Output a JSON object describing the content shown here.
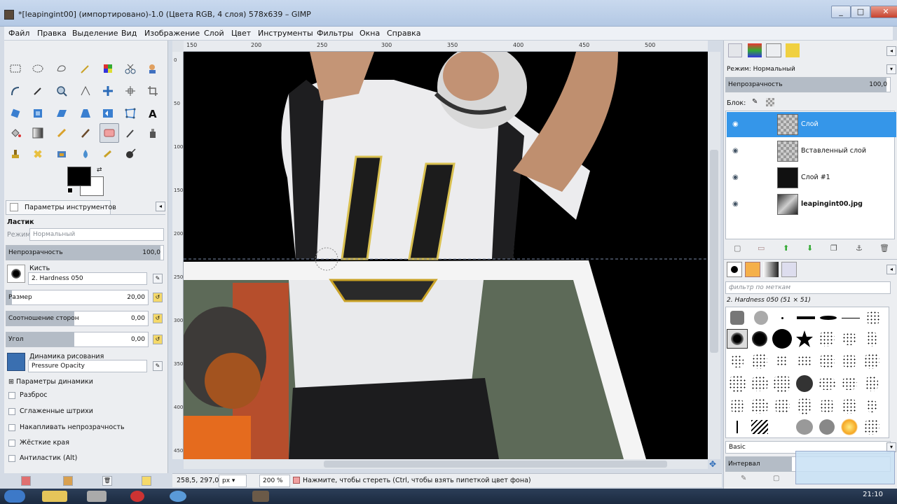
{
  "window": {
    "title": "*[leapingint00] (импортировано)-1.0 (Цвета RGB, 4 слоя) 578x639 – GIMP",
    "minimize": "_",
    "maximize": "□",
    "close": "✕"
  },
  "menu": [
    "Файл",
    "Правка",
    "Выделение",
    "Вид",
    "Изображение",
    "Слой",
    "Цвет",
    "Инструменты",
    "Фильтры",
    "Окна",
    "Справка"
  ],
  "tool_options": {
    "tab_label": "Параметры инструментов",
    "tool_name": "Ластик",
    "mode_label": "Режим:",
    "mode_value": "Нормальный",
    "opacity_label": "Непрозрачность",
    "opacity_value": "100,0",
    "brush_label": "Кисть",
    "brush_value": "2. Hardness 050",
    "size_label": "Размер",
    "size_value": "20,00",
    "aspect_label": "Соотношение сторон",
    "aspect_value": "0,00",
    "angle_label": "Угол",
    "angle_value": "0,00",
    "dynamics_label": "Динамика рисования",
    "dynamics_value": "Pressure Opacity",
    "dynamics_options": "Параметры динамики",
    "checkboxes": [
      "Разброс",
      "Сглаженные штрихи",
      "Накапливать непрозрачность",
      "Жёсткие края",
      "Антиластик (Alt)"
    ]
  },
  "rulers": {
    "top": [
      "150",
      "200",
      "250",
      "300",
      "350",
      "400",
      "450",
      "500"
    ],
    "left": [
      "0",
      "50",
      "100",
      "150",
      "200",
      "250",
      "300",
      "350",
      "400",
      "450"
    ]
  },
  "status": {
    "coords": "258,5, 297,0",
    "unit": "px",
    "zoom": "200 %",
    "message": "Нажмите, чтобы стереть (Ctrl, чтобы взять пипеткой цвет фона)"
  },
  "layers": {
    "mode_label": "Режим:",
    "mode_value": "Нормальный",
    "opacity_label": "Непрозрачность",
    "opacity_value": "100,0",
    "lock_label": "Блок:",
    "items": [
      {
        "name": "Слой"
      },
      {
        "name": "Вставленный слой"
      },
      {
        "name": "Слой #1"
      },
      {
        "name": "leapingint00.jpg"
      }
    ]
  },
  "brushes": {
    "filter_placeholder": "фильтр по меткам",
    "current": "2. Hardness 050 (51 × 51)",
    "preset": "Basic",
    "spacing_label": "Интервал"
  },
  "taskbar": {
    "clock": "21:10"
  },
  "colors": {
    "accent": "#3596e9",
    "titlebar": "#c9d9ee"
  }
}
